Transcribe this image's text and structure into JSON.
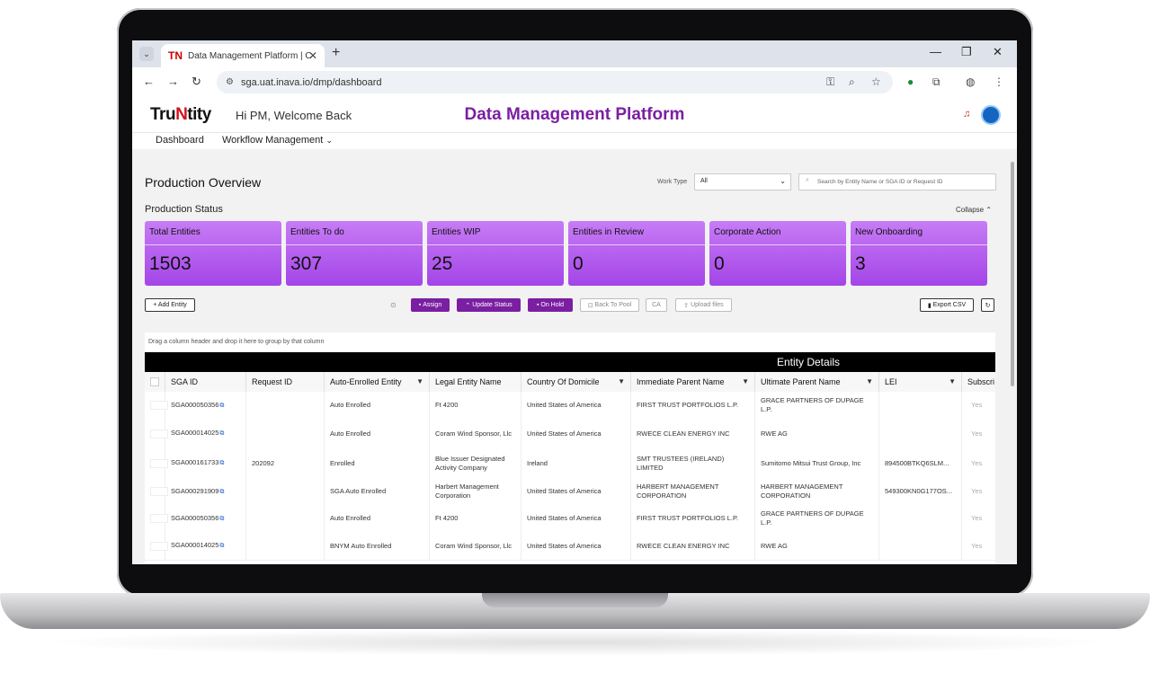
{
  "browser": {
    "tab_title": "Data Management Platform | C",
    "tab_favicon": "TN",
    "url": "sga.uat.inava.io/dmp/dashboard"
  },
  "header": {
    "logo_a": "Tru",
    "logo_b": "N",
    "logo_c": "tity",
    "welcome": "Hi PM, Welcome Back",
    "title": "Data Management Platform"
  },
  "menu": {
    "dashboard": "Dashboard",
    "workflow": "Workflow Management"
  },
  "page": {
    "title": "Production Overview",
    "work_type_label": "Work Type",
    "work_type_value": "All",
    "search_placeholder": "Search by Entity Name or SGA ID or Request ID",
    "status_title": "Production Status",
    "collapse": "Collapse"
  },
  "cards": [
    {
      "label": "Total Entities",
      "value": "1503"
    },
    {
      "label": "Entities To do",
      "value": "307"
    },
    {
      "label": "Entities WIP",
      "value": "25"
    },
    {
      "label": "Entities in Review",
      "value": "0"
    },
    {
      "label": "Corporate Action",
      "value": "0"
    },
    {
      "label": "New Onboarding",
      "value": "3"
    }
  ],
  "actions": {
    "add_entity": "+ Add Entity",
    "assign": "Assign",
    "update_status": "Update Status",
    "on_hold": "On Hold",
    "back_to_pool": "Back To Pool",
    "ca": "CA",
    "upload_files": "Upload files",
    "export_csv": "Export CSV"
  },
  "grid": {
    "drag_hint": "Drag a column header and drop it here to group by that column",
    "group_header": "Entity Details",
    "columns": [
      "SGA ID",
      "Request ID",
      "Auto-Enrolled Entity",
      "Legal Entity Name",
      "Country Of Domicile",
      "Immediate Parent Name",
      "Ultimate Parent Name",
      "LEI",
      "Subscri"
    ],
    "rows": [
      [
        "SGA000050356",
        "",
        "Auto Enrolled",
        "Ft 4200",
        "United States of America",
        "FIRST TRUST PORTFOLIOS L.P.",
        "GRACE PARTNERS OF DUPAGE L.P.",
        "",
        "Yes"
      ],
      [
        "SGA000014025",
        "",
        "Auto Enrolled",
        "Coram Wind Sponsor, Llc",
        "United States of America",
        "RWECE CLEAN ENERGY INC",
        "RWE AG",
        "",
        "Yes"
      ],
      [
        "SGA000161733",
        "202092",
        "Enrolled",
        "Blue Issuer Designated Activity Company",
        "Ireland",
        "SMT TRUSTEES (IRELAND) LIMITED",
        "Sumitomo Mitsui Trust Group, Inc",
        "894500BTKQ6SLM...",
        "Yes"
      ],
      [
        "SGA000291909",
        "",
        "SGA Auto Enrolled",
        "Harbert Management Corporation",
        "United States of America",
        "HARBERT MANAGEMENT CORPORATION",
        "HARBERT MANAGEMENT CORPORATION",
        "549300KN0G177OS...",
        "Yes"
      ],
      [
        "SGA000050356",
        "",
        "Auto Enrolled",
        "Ft 4200",
        "United States of America",
        "FIRST TRUST PORTFOLIOS L.P.",
        "GRACE PARTNERS OF DUPAGE L.P.",
        "",
        "Yes"
      ],
      [
        "SGA000014025",
        "",
        "BNYM Auto Enrolled",
        "Coram Wind Sponsor, Llc",
        "United States of America",
        "RWECE CLEAN ENERGY INC",
        "RWE AG",
        "",
        "Yes"
      ]
    ]
  },
  "colors": {
    "accent": "#7b1fa2",
    "card_gradient_top": "#c77cf5",
    "card_gradient_bottom": "#a445e8"
  }
}
